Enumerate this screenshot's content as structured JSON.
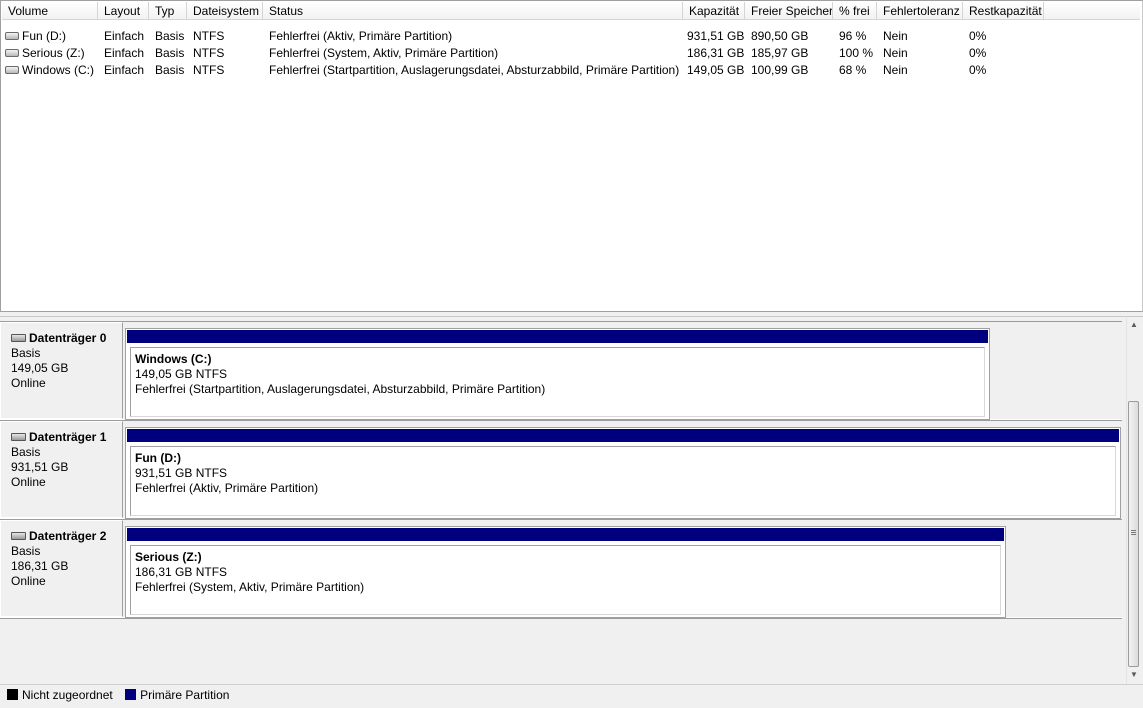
{
  "columns": [
    "Volume",
    "Layout",
    "Typ",
    "Dateisystem",
    "Status",
    "Kapazität",
    "Freier Speicher",
    "% frei",
    "Fehlertoleranz",
    "Restkapazität"
  ],
  "volumes": [
    {
      "icon": "drive-icon",
      "volume": "Fun (D:)",
      "layout": "Einfach",
      "typ": "Basis",
      "fs": "NTFS",
      "status": "Fehlerfrei (Aktiv, Primäre Partition)",
      "capacity": "931,51 GB",
      "free": "890,50 GB",
      "pct": "96 %",
      "fault": "Nein",
      "rest": "0%"
    },
    {
      "icon": "drive-icon",
      "volume": "Serious (Z:)",
      "layout": "Einfach",
      "typ": "Basis",
      "fs": "NTFS",
      "status": "Fehlerfrei (System, Aktiv, Primäre Partition)",
      "capacity": "186,31 GB",
      "free": "185,97 GB",
      "pct": "100 %",
      "fault": "Nein",
      "rest": "0%"
    },
    {
      "icon": "drive-icon",
      "volume": "Windows (C:)",
      "layout": "Einfach",
      "typ": "Basis",
      "fs": "NTFS",
      "status": "Fehlerfrei (Startpartition, Auslagerungsdatei, Absturzabbild, Primäre Partition)",
      "capacity": "149,05 GB",
      "free": "100,99 GB",
      "pct": "68 %",
      "fault": "Nein",
      "rest": "0%"
    }
  ],
  "disks": [
    {
      "icon": "hard-disk-icon",
      "title": "Datenträger 0",
      "type": "Basis",
      "size": "149,05 GB",
      "state": "Online",
      "partition": {
        "name": "Windows  (C:)",
        "size": "149,05 GB NTFS",
        "status": "Fehlerfrei (Startpartition, Auslagerungsdatei, Absturzabbild, Primäre Partition)"
      }
    },
    {
      "icon": "hard-disk-icon",
      "title": "Datenträger 1",
      "type": "Basis",
      "size": "931,51 GB",
      "state": "Online",
      "partition": {
        "name": "Fun  (D:)",
        "size": "931,51 GB NTFS",
        "status": "Fehlerfrei (Aktiv, Primäre Partition)"
      }
    },
    {
      "icon": "hard-disk-icon",
      "title": "Datenträger 2",
      "type": "Basis",
      "size": "186,31 GB",
      "state": "Online",
      "partition": {
        "name": "Serious  (Z:)",
        "size": "186,31 GB NTFS",
        "status": "Fehlerfrei (System, Aktiv, Primäre Partition)"
      }
    }
  ],
  "legend": [
    {
      "label": "Nicht zugeordnet",
      "color": "#000000"
    },
    {
      "label": "Primäre Partition",
      "color": "#00007f"
    }
  ],
  "colors": {
    "primary_partition": "#00007f",
    "unallocated": "#000000"
  }
}
